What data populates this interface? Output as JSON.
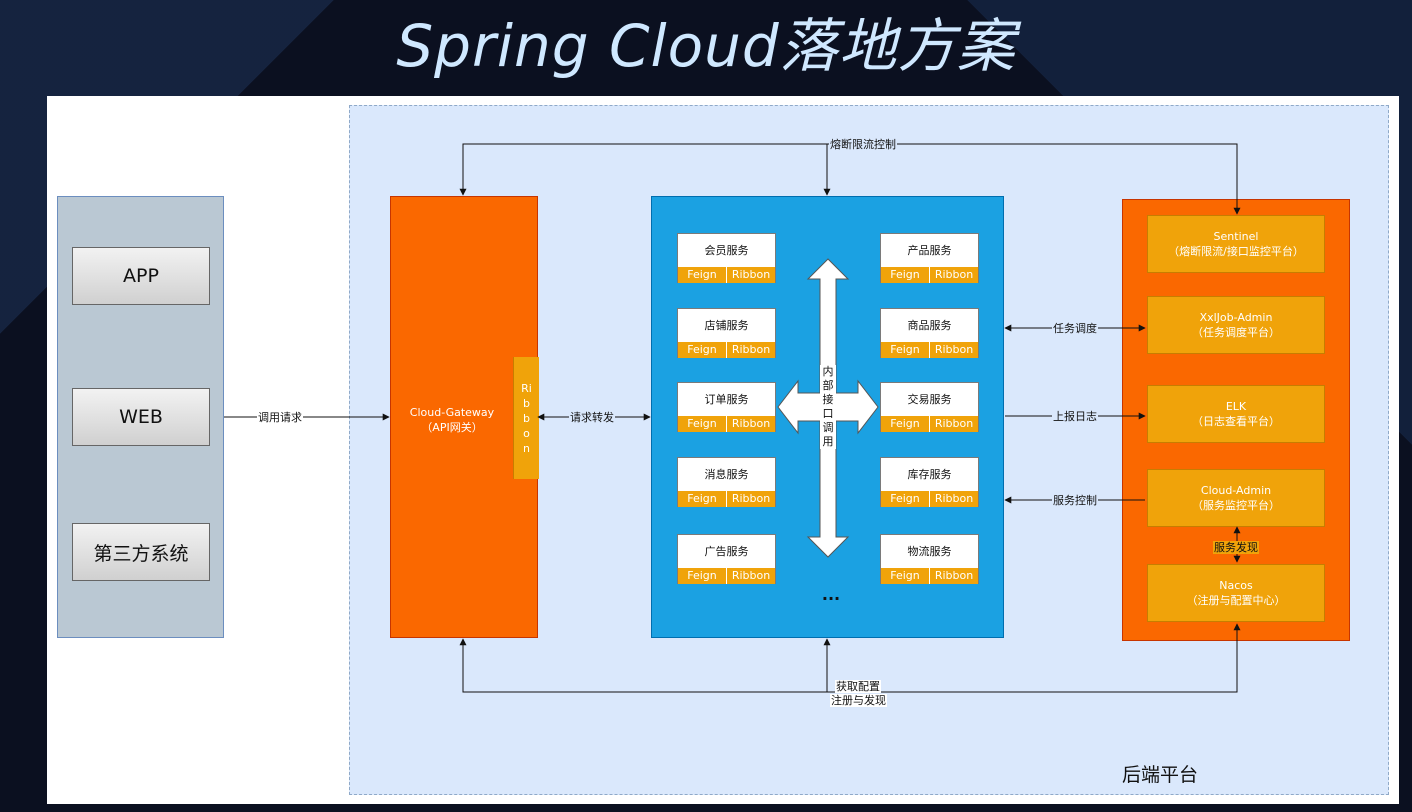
{
  "title": "Spring Cloud落地方案",
  "backend_label": "后端平台",
  "clients": [
    "APP",
    "WEB",
    "第三方系统"
  ],
  "gateway": {
    "line1": "Cloud-Gateway",
    "line2": "（API网关）",
    "ribbon": "Ribbon"
  },
  "services": {
    "left": [
      "会员服务",
      "店铺服务",
      "订单服务",
      "消息服务",
      "广告服务"
    ],
    "right": [
      "产品服务",
      "商品服务",
      "交易服务",
      "库存服务",
      "物流服务"
    ],
    "tag_feign": "Feign",
    "tag_ribbon": "Ribbon",
    "internal_call": "内部接口调用",
    "more": "..."
  },
  "platform": [
    {
      "line1": "Sentinel",
      "line2": "（熔断限流/接口监控平台）"
    },
    {
      "line1": "XxlJob-Admin",
      "line2": "（任务调度平台）"
    },
    {
      "line1": "ELK",
      "line2": "（日志查看平台）"
    },
    {
      "line1": "Cloud-Admin",
      "line2": "（服务监控平台）"
    },
    {
      "line1": "Nacos",
      "line2": "（注册与配置中心）"
    }
  ],
  "edges": {
    "call_request": "调用请求",
    "forward_request": "请求转发",
    "circuit_break": "熔断限流控制",
    "task_schedule": "任务调度",
    "report_log": "上报日志",
    "service_control": "服务控制",
    "service_discovery": "服务发现",
    "get_config": "获取配置",
    "register_discover": "注册与发现"
  },
  "colors": {
    "orange": "#fa6800",
    "amber": "#f0a30a",
    "blue": "#1ba1e2",
    "light_blue": "#dae8fc",
    "gray": "#bac8d3"
  }
}
